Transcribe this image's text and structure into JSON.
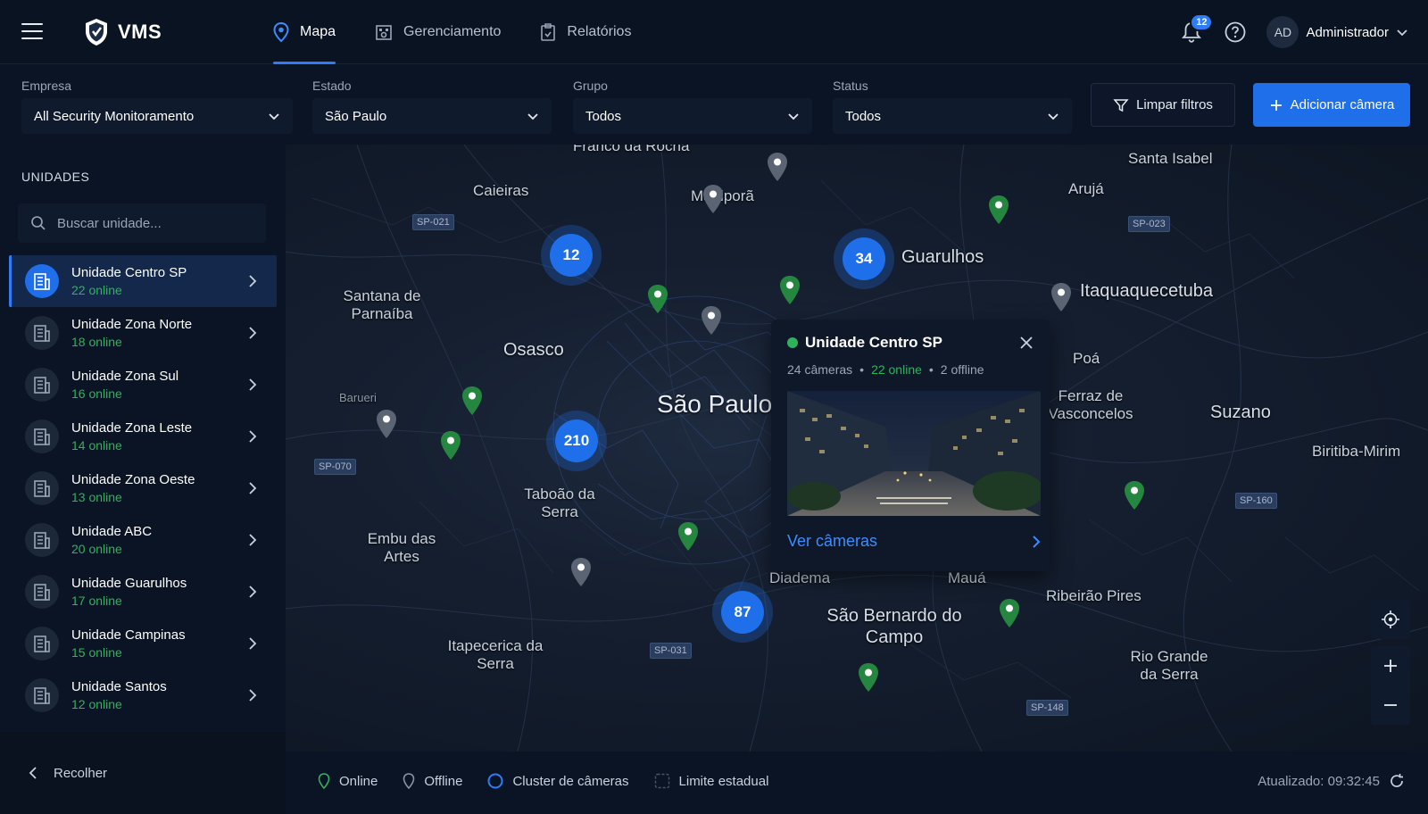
{
  "brand": {
    "name": "VMS"
  },
  "nav": [
    {
      "label": "Mapa",
      "icon": "map-pin-icon"
    },
    {
      "label": "Gerenciamento",
      "icon": "building-gear-icon"
    },
    {
      "label": "Relatórios",
      "icon": "report-icon"
    }
  ],
  "header": {
    "notifications": "12",
    "avatar_initials": "AD",
    "user_name": "Administrador"
  },
  "filters": {
    "empresa": {
      "label": "Empresa",
      "value": "All Security Monitoramento"
    },
    "estado": {
      "label": "Estado",
      "value": "São Paulo"
    },
    "grupo": {
      "label": "Grupo",
      "value": "Todos"
    },
    "status": {
      "label": "Status",
      "value": "Todos"
    },
    "clear_label": "Limpar filtros",
    "add_label": "Adicionar câmera"
  },
  "sidebar": {
    "title": "UNIDADES",
    "search_placeholder": "Buscar unidade...",
    "units": [
      {
        "name": "Unidade Centro SP",
        "status": "22 online"
      },
      {
        "name": "Unidade Zona Norte",
        "status": "18 online"
      },
      {
        "name": "Unidade Zona Sul",
        "status": "16 online"
      },
      {
        "name": "Unidade Zona Leste",
        "status": "14 online"
      },
      {
        "name": "Unidade Zona Oeste",
        "status": "13 online"
      },
      {
        "name": "Unidade ABC",
        "status": "20 online"
      },
      {
        "name": "Unidade Guarulhos",
        "status": "17 online"
      },
      {
        "name": "Unidade Campinas",
        "status": "15 online"
      },
      {
        "name": "Unidade Santos",
        "status": "12 online"
      }
    ],
    "collapse_label": "Recolher"
  },
  "map": {
    "cities": {
      "franco": "Franco da Rocha",
      "caieiras": "Caieiras",
      "mairipora": "Mairiporã",
      "santa_isabel": "Santa Isabel",
      "aruja": "Arujá",
      "guarulhos": "Guarulhos",
      "itaqua": "Itaquaquecetuba",
      "santana": "Santana de Parnaíba",
      "osasco": "Osasco",
      "sao_paulo": "São Paulo",
      "poa": "Poá",
      "ferraz": "Ferraz de Vasconcelos",
      "suzano": "Suzano",
      "biritiba": "Biritiba-Mirim",
      "barueri": "Barueri",
      "taboao": "Taboão da Serra",
      "embu": "Embu das Artes",
      "diadema": "Diadema",
      "maua": "Mauá",
      "sbc": "São Bernardo do Campo",
      "ribeirao": "Ribeirão Pires",
      "rio_grande": "Rio Grande da Serra",
      "itapecerica": "Itapecerica da Serra"
    },
    "roads": {
      "sp021": "SP-021",
      "sp023": "SP-023",
      "sp070": "SP-070",
      "sp160": "SP-160",
      "sp031": "SP-031",
      "sp148": "SP-148"
    },
    "clusters": {
      "c1": "12",
      "c2": "34",
      "c3": "210",
      "c4": "87"
    }
  },
  "popup": {
    "title": "Unidade Centro SP",
    "cameras": "24 câmeras",
    "online": "22 online",
    "offline": "2 offline",
    "link": "Ver câmeras"
  },
  "legend": {
    "online": "Online",
    "offline": "Offline",
    "cluster": "Cluster de câmeras",
    "limit": "Limite estadual",
    "updated": "Atualizado: 09:32:45"
  },
  "colors": {
    "accent": "#1f6feb",
    "online": "#2fb35a",
    "offline": "#8a94a3",
    "background": "#0b1424"
  }
}
